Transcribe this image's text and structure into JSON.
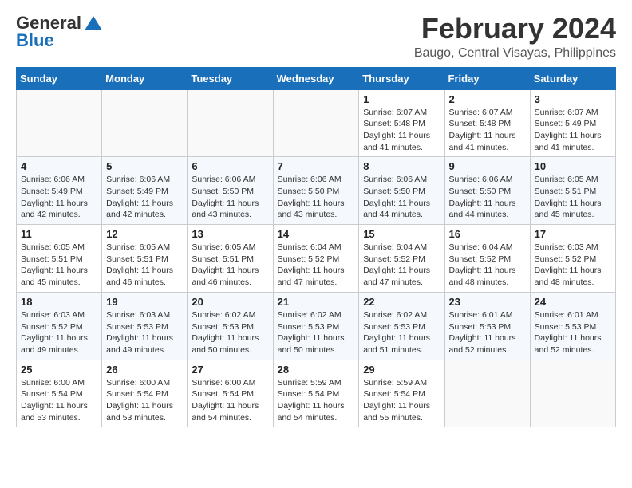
{
  "logo": {
    "general": "General",
    "blue": "Blue"
  },
  "header": {
    "month": "February 2024",
    "location": "Baugo, Central Visayas, Philippines"
  },
  "weekdays": [
    "Sunday",
    "Monday",
    "Tuesday",
    "Wednesday",
    "Thursday",
    "Friday",
    "Saturday"
  ],
  "weeks": [
    [
      {
        "day": "",
        "info": ""
      },
      {
        "day": "",
        "info": ""
      },
      {
        "day": "",
        "info": ""
      },
      {
        "day": "",
        "info": ""
      },
      {
        "day": "1",
        "info": "Sunrise: 6:07 AM\nSunset: 5:48 PM\nDaylight: 11 hours and 41 minutes."
      },
      {
        "day": "2",
        "info": "Sunrise: 6:07 AM\nSunset: 5:48 PM\nDaylight: 11 hours and 41 minutes."
      },
      {
        "day": "3",
        "info": "Sunrise: 6:07 AM\nSunset: 5:49 PM\nDaylight: 11 hours and 41 minutes."
      }
    ],
    [
      {
        "day": "4",
        "info": "Sunrise: 6:06 AM\nSunset: 5:49 PM\nDaylight: 11 hours and 42 minutes."
      },
      {
        "day": "5",
        "info": "Sunrise: 6:06 AM\nSunset: 5:49 PM\nDaylight: 11 hours and 42 minutes."
      },
      {
        "day": "6",
        "info": "Sunrise: 6:06 AM\nSunset: 5:50 PM\nDaylight: 11 hours and 43 minutes."
      },
      {
        "day": "7",
        "info": "Sunrise: 6:06 AM\nSunset: 5:50 PM\nDaylight: 11 hours and 43 minutes."
      },
      {
        "day": "8",
        "info": "Sunrise: 6:06 AM\nSunset: 5:50 PM\nDaylight: 11 hours and 44 minutes."
      },
      {
        "day": "9",
        "info": "Sunrise: 6:06 AM\nSunset: 5:50 PM\nDaylight: 11 hours and 44 minutes."
      },
      {
        "day": "10",
        "info": "Sunrise: 6:05 AM\nSunset: 5:51 PM\nDaylight: 11 hours and 45 minutes."
      }
    ],
    [
      {
        "day": "11",
        "info": "Sunrise: 6:05 AM\nSunset: 5:51 PM\nDaylight: 11 hours and 45 minutes."
      },
      {
        "day": "12",
        "info": "Sunrise: 6:05 AM\nSunset: 5:51 PM\nDaylight: 11 hours and 46 minutes."
      },
      {
        "day": "13",
        "info": "Sunrise: 6:05 AM\nSunset: 5:51 PM\nDaylight: 11 hours and 46 minutes."
      },
      {
        "day": "14",
        "info": "Sunrise: 6:04 AM\nSunset: 5:52 PM\nDaylight: 11 hours and 47 minutes."
      },
      {
        "day": "15",
        "info": "Sunrise: 6:04 AM\nSunset: 5:52 PM\nDaylight: 11 hours and 47 minutes."
      },
      {
        "day": "16",
        "info": "Sunrise: 6:04 AM\nSunset: 5:52 PM\nDaylight: 11 hours and 48 minutes."
      },
      {
        "day": "17",
        "info": "Sunrise: 6:03 AM\nSunset: 5:52 PM\nDaylight: 11 hours and 48 minutes."
      }
    ],
    [
      {
        "day": "18",
        "info": "Sunrise: 6:03 AM\nSunset: 5:52 PM\nDaylight: 11 hours and 49 minutes."
      },
      {
        "day": "19",
        "info": "Sunrise: 6:03 AM\nSunset: 5:53 PM\nDaylight: 11 hours and 49 minutes."
      },
      {
        "day": "20",
        "info": "Sunrise: 6:02 AM\nSunset: 5:53 PM\nDaylight: 11 hours and 50 minutes."
      },
      {
        "day": "21",
        "info": "Sunrise: 6:02 AM\nSunset: 5:53 PM\nDaylight: 11 hours and 50 minutes."
      },
      {
        "day": "22",
        "info": "Sunrise: 6:02 AM\nSunset: 5:53 PM\nDaylight: 11 hours and 51 minutes."
      },
      {
        "day": "23",
        "info": "Sunrise: 6:01 AM\nSunset: 5:53 PM\nDaylight: 11 hours and 52 minutes."
      },
      {
        "day": "24",
        "info": "Sunrise: 6:01 AM\nSunset: 5:53 PM\nDaylight: 11 hours and 52 minutes."
      }
    ],
    [
      {
        "day": "25",
        "info": "Sunrise: 6:00 AM\nSunset: 5:54 PM\nDaylight: 11 hours and 53 minutes."
      },
      {
        "day": "26",
        "info": "Sunrise: 6:00 AM\nSunset: 5:54 PM\nDaylight: 11 hours and 53 minutes."
      },
      {
        "day": "27",
        "info": "Sunrise: 6:00 AM\nSunset: 5:54 PM\nDaylight: 11 hours and 54 minutes."
      },
      {
        "day": "28",
        "info": "Sunrise: 5:59 AM\nSunset: 5:54 PM\nDaylight: 11 hours and 54 minutes."
      },
      {
        "day": "29",
        "info": "Sunrise: 5:59 AM\nSunset: 5:54 PM\nDaylight: 11 hours and 55 minutes."
      },
      {
        "day": "",
        "info": ""
      },
      {
        "day": "",
        "info": ""
      }
    ]
  ]
}
